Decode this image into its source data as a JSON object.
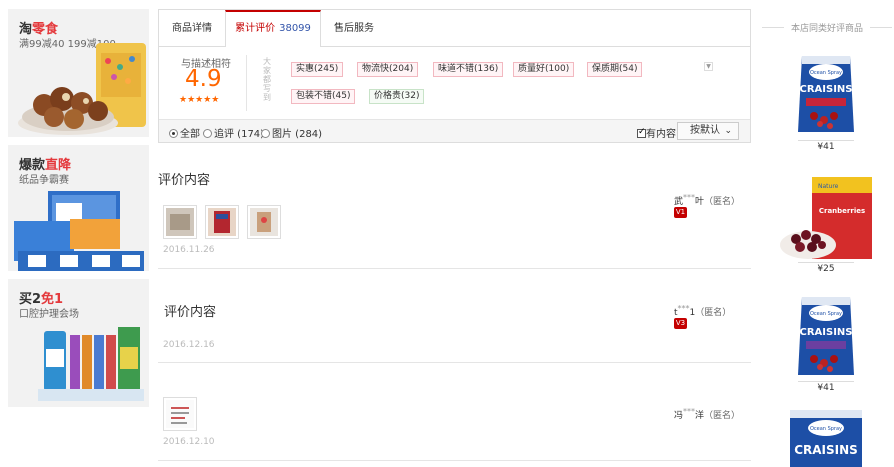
{
  "promos": [
    {
      "title_a": "淘",
      "title_b": "零食",
      "subtitle": "满99减40 199减100"
    },
    {
      "title_a": "爆款",
      "title_b": "直降",
      "subtitle": "纸品争霸赛"
    },
    {
      "title_a": "买2",
      "title_b": "免1",
      "subtitle": "口腔护理会场"
    }
  ],
  "tabs": [
    {
      "label": "商品详情"
    },
    {
      "label": "累计评价",
      "count": "38099"
    },
    {
      "label": "售后服务"
    }
  ],
  "rating": {
    "label": "与描述相符",
    "score": "4.9",
    "stars": "★★★★★",
    "side_text": "大家都写到"
  },
  "tags": [
    {
      "label": "实惠(245)"
    },
    {
      "label": "物流快(204)"
    },
    {
      "label": "味道不错(136)"
    },
    {
      "label": "质量好(100)"
    },
    {
      "label": "保质期(54)"
    },
    {
      "label": "包装不错(45)"
    },
    {
      "label": "价格贵(32)"
    }
  ],
  "filters": {
    "all": "全部",
    "append": "追评 (174)",
    "pictures": "图片 (284)",
    "has_content": "有内容",
    "sort": "按默认"
  },
  "reviews": [
    {
      "text": "评价内容",
      "date": "2016.11.26",
      "user_a": "武",
      "user_mask": "***",
      "user_b": "叶",
      "anon": "（匿名）",
      "badge": "V1"
    },
    {
      "text": "评价内容",
      "date": "2016.12.16",
      "user_a": "t",
      "user_mask": "***",
      "user_b": "1",
      "anon": "（匿名）",
      "badge": "V3"
    },
    {
      "text": "",
      "date": "2016.12.10",
      "user_a": "冯",
      "user_mask": "***",
      "user_b": "洋",
      "anon": "（匿名）"
    }
  ],
  "recommend": {
    "title": "本店同类好评商品",
    "items": [
      {
        "brand": "Ocean Spray",
        "name": "CRAISINS",
        "price": "¥41"
      },
      {
        "brand": "Nature",
        "name": "Cranberries",
        "price": "¥25"
      },
      {
        "brand": "Ocean Spray",
        "name": "CRAISINS",
        "price": "¥41"
      },
      {
        "brand": "Ocean Spray",
        "name": "CRAISINS",
        "price": ""
      }
    ]
  },
  "colors": {
    "accent": "#c40000",
    "score": "#ff6600",
    "promo_bg": "#f2f2f2"
  }
}
